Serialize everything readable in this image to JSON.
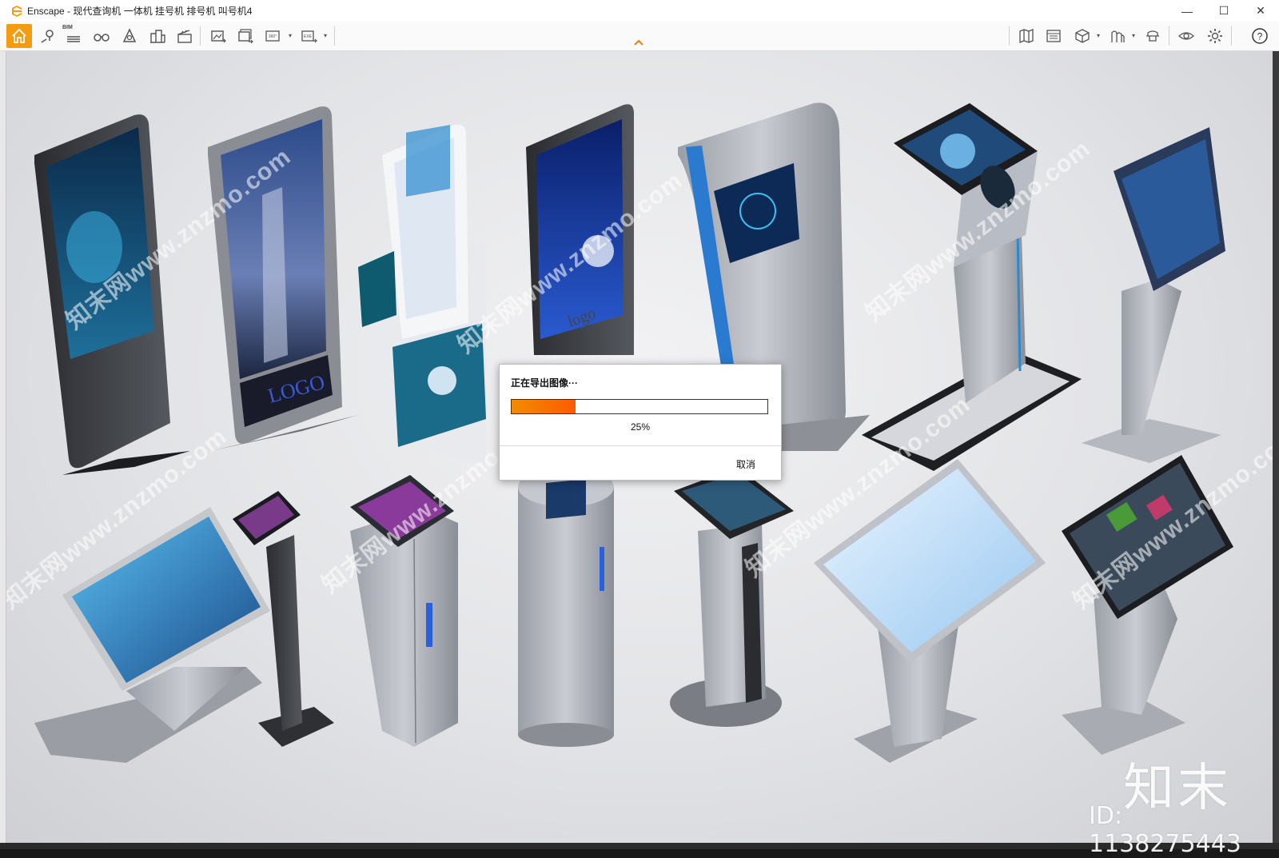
{
  "window": {
    "title": "Enscape - 现代查询机 一体机 挂号机 排号机 叫号机4",
    "controls": {
      "minimize": "—",
      "maximize": "☐",
      "close": "✕"
    },
    "accent_color": "#f39c12"
  },
  "toolbar": {
    "left_icons": [
      "home-icon",
      "location-pin-icon",
      "bim-icon",
      "binoculars-icon",
      "asset-library-icon",
      "buildings-icon",
      "clapperboard-icon",
      "screenshot-export-icon",
      "batch-export-icon",
      "panorama-export-icon",
      "exe-export-icon"
    ],
    "bim_label": "BIM",
    "pano_label": "360°",
    "exe_label": "EXE",
    "right_icons": [
      "map-icon",
      "media-icon",
      "cube-view-icon",
      "atmosphere-icon",
      "hat-icon",
      "eye-icon",
      "settings-icon",
      "help-icon"
    ],
    "help_label": "?"
  },
  "viewport": {
    "watermark_text": "知末网www.znzmo.com",
    "brand_cn": "知末",
    "brand_id": "ID: 1138275443"
  },
  "dialog": {
    "title": "正在导出图像···",
    "progress_fraction": 0.25,
    "progress_color_start": "#f28c00",
    "progress_color_end": "#ff5a00",
    "percent_text": "25%",
    "cancel_label": "取消"
  }
}
